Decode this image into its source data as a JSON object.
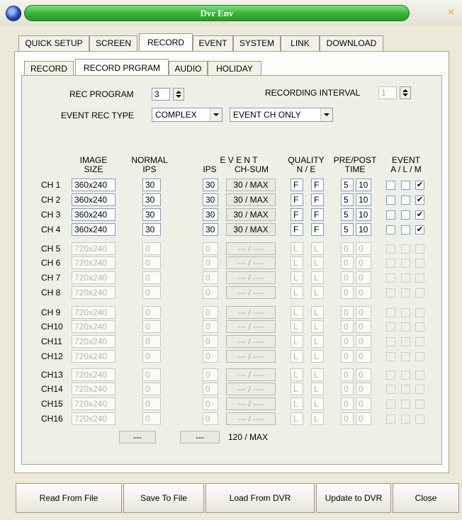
{
  "window": {
    "title": "Dvr Env",
    "close_glyph": "×"
  },
  "top_tabs": [
    "QUICK SETUP",
    "SCREEN",
    "RECORD",
    "EVENT",
    "SYSTEM",
    "LINK",
    "DOWNLOAD"
  ],
  "sub_tabs": [
    "RECORD",
    "RECORD PRGRAM",
    "AUDIO",
    "HOLIDAY"
  ],
  "settings": {
    "rec_program_label": "REC PROGRAM",
    "rec_program_value": "3",
    "recording_interval_label": "RECORDING INTERVAL",
    "recording_interval_value": "1",
    "event_rec_type_label": "EVENT REC TYPE",
    "event_rec_type_value": "COMPLEX",
    "event_ch_value": "EVENT CH ONLY"
  },
  "headers": {
    "image_size": "IMAGE\nSIZE",
    "normal_ips": "NORMAL\nIPS",
    "event": "E V E N T",
    "event_ips": "IPS",
    "event_chsum": "CH-SUM",
    "quality": "QUALITY\nN / E",
    "prepost": "PRE/POST\nTIME",
    "event_alm": "EVENT\nA / L / M"
  },
  "rows": [
    {
      "ch": "CH 1",
      "size": "360x240",
      "ips": "30",
      "eips": "30",
      "chsum": "30 / MAX",
      "qn": "F",
      "qe": "F",
      "pre": "5",
      "post": "10",
      "a": false,
      "l": false,
      "m": true,
      "enabled": true
    },
    {
      "ch": "CH 2",
      "size": "360x240",
      "ips": "30",
      "eips": "30",
      "chsum": "30 / MAX",
      "qn": "F",
      "qe": "F",
      "pre": "5",
      "post": "10",
      "a": false,
      "l": false,
      "m": true,
      "enabled": true
    },
    {
      "ch": "CH 3",
      "size": "360x240",
      "ips": "30",
      "eips": "30",
      "chsum": "30 / MAX",
      "qn": "F",
      "qe": "F",
      "pre": "5",
      "post": "10",
      "a": false,
      "l": false,
      "m": true,
      "enabled": true
    },
    {
      "ch": "CH 4",
      "size": "360x240",
      "ips": "30",
      "eips": "30",
      "chsum": "30 / MAX",
      "qn": "F",
      "qe": "F",
      "pre": "5",
      "post": "10",
      "a": false,
      "l": false,
      "m": true,
      "enabled": true
    },
    {
      "ch": "CH 5",
      "size": "720x240",
      "ips": "0",
      "eips": "0",
      "chsum": "--- / ----",
      "qn": "L",
      "qe": "L",
      "pre": "0",
      "post": "0",
      "a": false,
      "l": false,
      "m": false,
      "enabled": false
    },
    {
      "ch": "CH 6",
      "size": "720x240",
      "ips": "0",
      "eips": "0",
      "chsum": "--- / ----",
      "qn": "L",
      "qe": "L",
      "pre": "0",
      "post": "0",
      "a": false,
      "l": false,
      "m": false,
      "enabled": false
    },
    {
      "ch": "CH 7",
      "size": "720x240",
      "ips": "0",
      "eips": "0",
      "chsum": "--- / ----",
      "qn": "L",
      "qe": "L",
      "pre": "0",
      "post": "0",
      "a": false,
      "l": false,
      "m": false,
      "enabled": false
    },
    {
      "ch": "CH 8",
      "size": "720x240",
      "ips": "0",
      "eips": "0",
      "chsum": "--- / ----",
      "qn": "L",
      "qe": "L",
      "pre": "0",
      "post": "0",
      "a": false,
      "l": false,
      "m": false,
      "enabled": false
    },
    {
      "ch": "CH 9",
      "size": "720x240",
      "ips": "0",
      "eips": "0",
      "chsum": "--- / ----",
      "qn": "L",
      "qe": "L",
      "pre": "0",
      "post": "0",
      "a": false,
      "l": false,
      "m": false,
      "enabled": false
    },
    {
      "ch": "CH10",
      "size": "720x240",
      "ips": "0",
      "eips": "0",
      "chsum": "--- / ----",
      "qn": "L",
      "qe": "L",
      "pre": "0",
      "post": "0",
      "a": false,
      "l": false,
      "m": false,
      "enabled": false
    },
    {
      "ch": "CH11",
      "size": "720x240",
      "ips": "0",
      "eips": "0",
      "chsum": "--- / ----",
      "qn": "L",
      "qe": "L",
      "pre": "0",
      "post": "0",
      "a": false,
      "l": false,
      "m": false,
      "enabled": false
    },
    {
      "ch": "CH12",
      "size": "720x240",
      "ips": "0",
      "eips": "0",
      "chsum": "--- / ----",
      "qn": "L",
      "qe": "L",
      "pre": "0",
      "post": "0",
      "a": false,
      "l": false,
      "m": false,
      "enabled": false
    },
    {
      "ch": "CH13",
      "size": "720x240",
      "ips": "0",
      "eips": "0",
      "chsum": "--- / ----",
      "qn": "L",
      "qe": "L",
      "pre": "0",
      "post": "0",
      "a": false,
      "l": false,
      "m": false,
      "enabled": false
    },
    {
      "ch": "CH14",
      "size": "720x240",
      "ips": "0",
      "eips": "0",
      "chsum": "--- / ----",
      "qn": "L",
      "qe": "L",
      "pre": "0",
      "post": "0",
      "a": false,
      "l": false,
      "m": false,
      "enabled": false
    },
    {
      "ch": "CH15",
      "size": "720x240",
      "ips": "0",
      "eips": "0",
      "chsum": "--- / ----",
      "qn": "L",
      "qe": "L",
      "pre": "0",
      "post": "0",
      "a": false,
      "l": false,
      "m": false,
      "enabled": false
    },
    {
      "ch": "CH16",
      "size": "720x240",
      "ips": "0",
      "eips": "0",
      "chsum": "--- / ----",
      "qn": "L",
      "qe": "L",
      "pre": "0",
      "post": "0",
      "a": false,
      "l": false,
      "m": false,
      "enabled": false
    }
  ],
  "totals": {
    "normal_ips": "---",
    "event_ips": "---",
    "chsum": "120 / MAX"
  },
  "buttons": [
    "Read From File",
    "Save To File",
    "Load From DVR",
    "Update to DVR",
    "Close"
  ],
  "colors": {
    "title_green": "#35b235",
    "check_mark": "✔"
  }
}
